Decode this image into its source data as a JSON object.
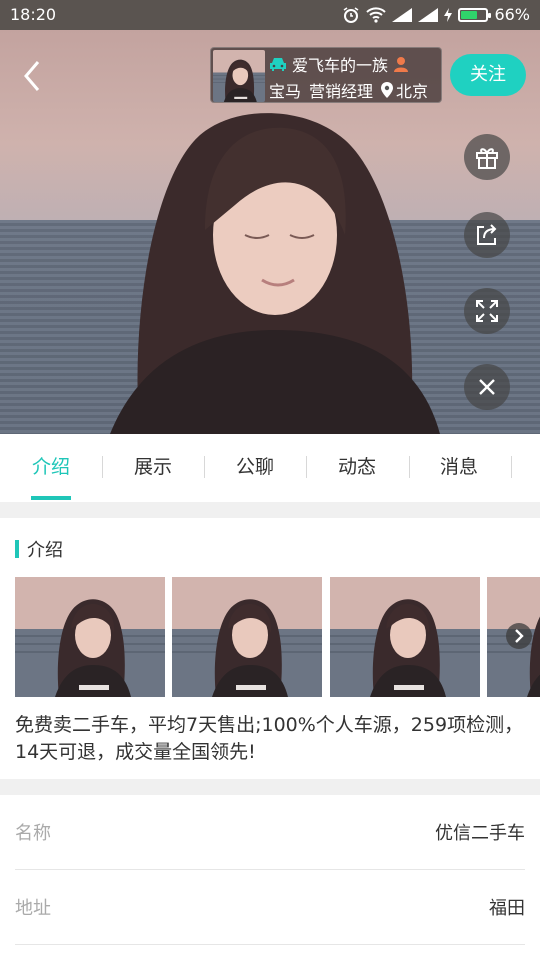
{
  "status_bar": {
    "time": "18:20",
    "battery_percent": "66%",
    "battery_level": 0.66,
    "icons": [
      "alarm-icon",
      "wifi-icon",
      "signal-icon",
      "signal-icon",
      "charging-icon",
      "battery-icon"
    ]
  },
  "profile": {
    "nickname": "爱飞车的一族",
    "brand": "宝马",
    "position": "营销经理",
    "location": "北京"
  },
  "actions": {
    "follow_label": "关注",
    "side_buttons": [
      "gift-icon",
      "share-icon",
      "fullscreen-icon",
      "close-icon"
    ]
  },
  "tabs": [
    {
      "label": "介绍",
      "active": true
    },
    {
      "label": "展示",
      "active": false
    },
    {
      "label": "公聊",
      "active": false
    },
    {
      "label": "动态",
      "active": false
    },
    {
      "label": "消息",
      "active": false
    }
  ],
  "intro": {
    "title": "介绍",
    "text": "免费卖二手车，平均7天售出;100%个人车源，259项检测，14天可退，成交量全国领先!"
  },
  "info": [
    {
      "label": "名称",
      "value": "优信二手车"
    },
    {
      "label": "地址",
      "value": "福田"
    }
  ],
  "colors": {
    "accent": "#1fc6b8",
    "follow": "#1fd1c1",
    "battery": "#2fd36b"
  }
}
